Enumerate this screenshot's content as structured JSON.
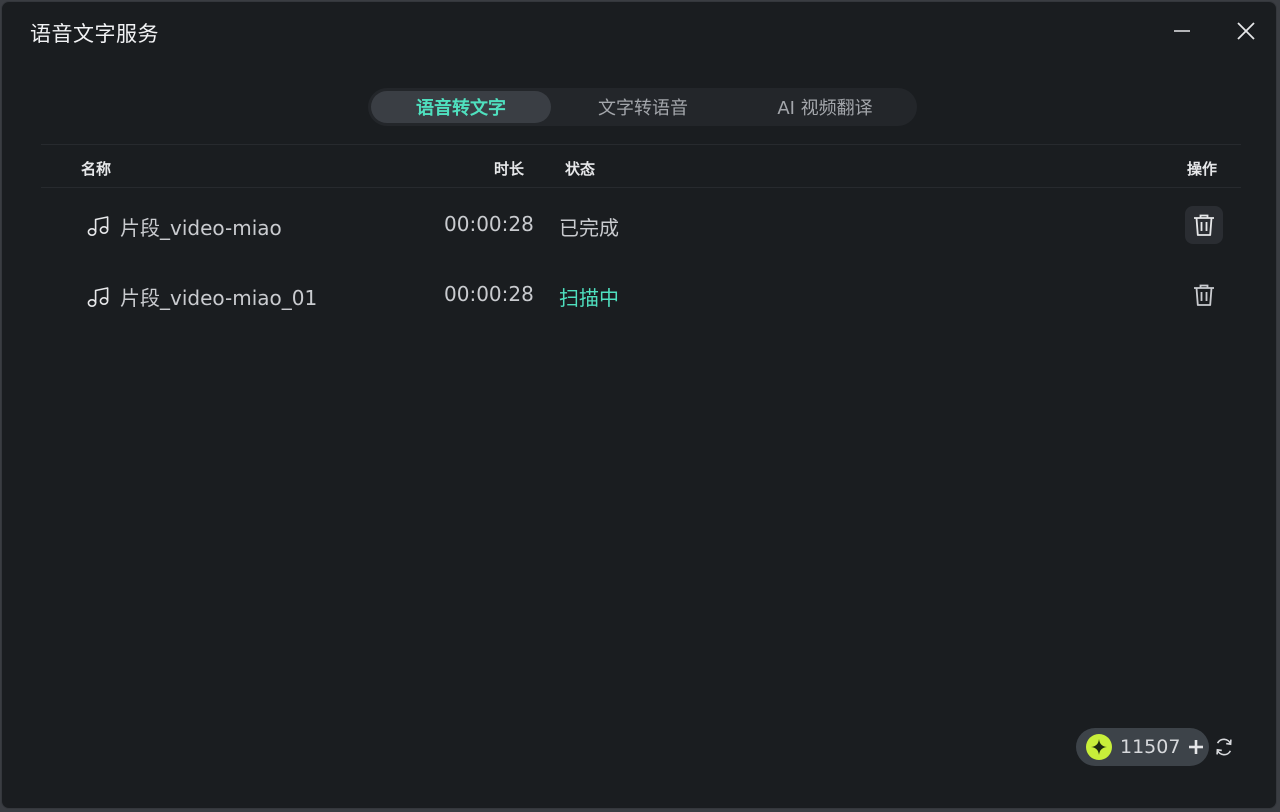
{
  "window": {
    "title": "语音文字服务"
  },
  "tabs": [
    {
      "label": "语音转文字",
      "active": true
    },
    {
      "label": "文字转语音",
      "active": false
    },
    {
      "label": "AI 视频翻译",
      "active": false
    }
  ],
  "table": {
    "headers": {
      "name": "名称",
      "duration": "时长",
      "status": "状态",
      "actions": "操作"
    },
    "rows": [
      {
        "icon": "music-note-icon",
        "name": "片段_video-miao",
        "duration": "00:00:28",
        "status": "已完成",
        "status_color": "#c9cbcf"
      },
      {
        "icon": "music-note-icon",
        "name": "片段_video-miao_01",
        "duration": "00:00:28",
        "status": "扫描中",
        "status_color": "#4fe0bf"
      }
    ]
  },
  "credits": {
    "value": "11507",
    "icon": "sparkle-coin-icon"
  },
  "colors": {
    "accent": "#4fe0bf",
    "background": "#1a1d20",
    "coin": "#c8ef3a"
  }
}
